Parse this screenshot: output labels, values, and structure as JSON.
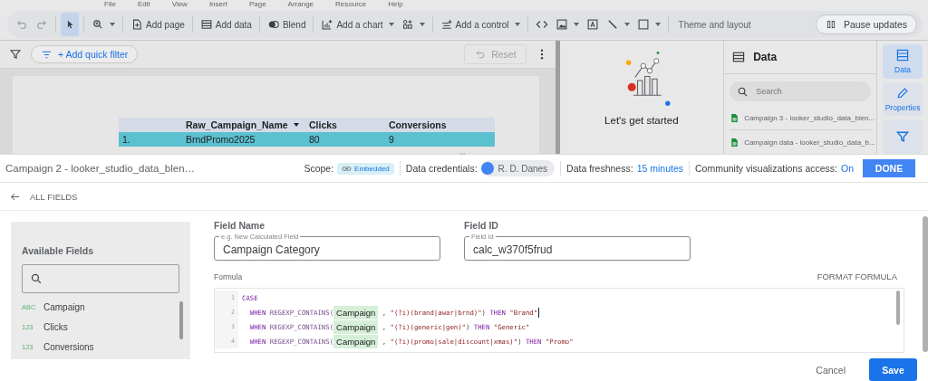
{
  "menu": [
    "File",
    "Edit",
    "View",
    "Insert",
    "Page",
    "Arrange",
    "Resource",
    "Help"
  ],
  "toolbar": [
    {
      "kind": "icon",
      "selected": false
    },
    {
      "kind": "icon",
      "selected": false
    },
    {
      "kind": "sep"
    },
    {
      "kind": "icon",
      "selected": true
    },
    {
      "kind": "sep"
    },
    {
      "kind": "icon",
      "caret": true,
      "selected": false
    },
    {
      "kind": "sep"
    },
    {
      "kind": "labeled",
      "label": "Add page"
    },
    {
      "kind": "sep"
    },
    {
      "kind": "labeled",
      "label": "Add data"
    },
    {
      "kind": "sep"
    },
    {
      "kind": "labeled",
      "label": "Blend"
    },
    {
      "kind": "sep"
    },
    {
      "kind": "labeled",
      "label": "Add a chart",
      "caret": true
    },
    {
      "kind": "icon",
      "caret": true,
      "selected": false
    },
    {
      "kind": "sep"
    },
    {
      "kind": "labeled",
      "label": "Add a control",
      "caret": true
    },
    {
      "kind": "sep"
    },
    {
      "kind": "icon",
      "selected": false
    },
    {
      "kind": "icon",
      "caret": true,
      "selected": false
    },
    {
      "kind": "icon",
      "selected": false
    },
    {
      "kind": "icon",
      "caret": true,
      "selected": false
    },
    {
      "kind": "icon",
      "caret": true,
      "selected": false
    },
    {
      "kind": "sep"
    },
    {
      "kind": "text",
      "label": "Theme and layout"
    }
  ],
  "pause_button": "Pause updates",
  "filter_bar": {
    "add_filter": "+ Add quick filter",
    "reset": "Reset"
  },
  "table": {
    "columns": [
      {
        "sorted": false
      },
      {
        "label": "Raw_Campaign_Name",
        "sorted": true
      },
      {
        "label": "Clicks",
        "sorted": false
      },
      {
        "label": "Conversions",
        "sorted": false
      }
    ],
    "rows": [
      {
        "cells": [
          "1.",
          "BrndPromo2025",
          "80",
          "9"
        ],
        "selected": true
      }
    ]
  },
  "get_started": "Let's get started",
  "data_panel": {
    "title": "Data",
    "search_placeholder": "Search",
    "sources": [
      "Campaign 3 - looker_studio_data_blen...",
      "Campaign data - looker_studio_data_b..."
    ]
  },
  "rail": [
    {
      "label": "Data",
      "selected": true
    },
    {
      "label": "Properties",
      "selected": false
    },
    {
      "selected": false
    }
  ],
  "editor_bar": {
    "title": "Campaign 2 - looker_studio_data_blen…",
    "scope_label": "Scope:",
    "scope": "Embedded",
    "credentials_label": "Data credentials:",
    "credentials": "R. D. Danes",
    "freshness_label": "Data freshness:",
    "freshness": "15 minutes",
    "community_label": "Community visualizations access:",
    "community": "On",
    "done": "DONE"
  },
  "back": "ALL FIELDS",
  "available_fields": {
    "title": "Available Fields",
    "items": [
      {
        "type": "ABC",
        "name": "Campaign"
      },
      {
        "type": "123",
        "name": "Clicks"
      },
      {
        "type": "123",
        "name": "Conversions"
      }
    ]
  },
  "field_name": {
    "label": "Field Name",
    "placeholder": "e.g. New Calculated Field",
    "value": "Campaign Category"
  },
  "field_id": {
    "label": "Field ID",
    "placeholder": "Field Id",
    "value": "calc_w370f5frud"
  },
  "formula": {
    "label": "Formula",
    "format": "FORMAT FORMULA",
    "lines": [
      {
        "number": "1",
        "segments": [
          {
            "kind": "keyword",
            "text": "CASE"
          }
        ]
      },
      {
        "number": "2",
        "segments": [
          {
            "kind": "keyword",
            "text": "  WHEN"
          },
          {
            "kind": "func",
            "text": " REGEXP_CONTAINS("
          },
          {
            "kind": "field",
            "text": "Campaign"
          },
          {
            "kind": "plain",
            "text": " , "
          },
          {
            "kind": "string",
            "text": "\"(?i)(brand|awar|brnd)\""
          },
          {
            "kind": "plain",
            "text": ") "
          },
          {
            "kind": "keyword",
            "text": "THEN "
          },
          {
            "kind": "string",
            "text": "\"Brand\""
          }
        ],
        "cursor": true
      },
      {
        "number": "3",
        "segments": [
          {
            "kind": "keyword",
            "text": "  WHEN"
          },
          {
            "kind": "func",
            "text": " REGEXP_CONTAINS("
          },
          {
            "kind": "field",
            "text": "Campaign"
          },
          {
            "kind": "plain",
            "text": " , "
          },
          {
            "kind": "string",
            "text": "\"(?i)(generic|gen)\""
          },
          {
            "kind": "plain",
            "text": ") "
          },
          {
            "kind": "keyword",
            "text": "THEN "
          },
          {
            "kind": "string",
            "text": "\"Generic\""
          }
        ]
      },
      {
        "number": "4",
        "segments": [
          {
            "kind": "keyword",
            "text": "  WHEN"
          },
          {
            "kind": "func",
            "text": " REGEXP_CONTAINS("
          },
          {
            "kind": "field",
            "text": "Campaign"
          },
          {
            "kind": "plain",
            "text": " , "
          },
          {
            "kind": "string",
            "text": "\"(?i)(promo|sale|discount|xmas)\""
          },
          {
            "kind": "plain",
            "text": ") "
          },
          {
            "kind": "keyword",
            "text": "THEN "
          },
          {
            "kind": "string",
            "text": "\"Promo\""
          }
        ]
      }
    ]
  },
  "buttons": {
    "cancel": "Cancel",
    "save": "Save"
  }
}
